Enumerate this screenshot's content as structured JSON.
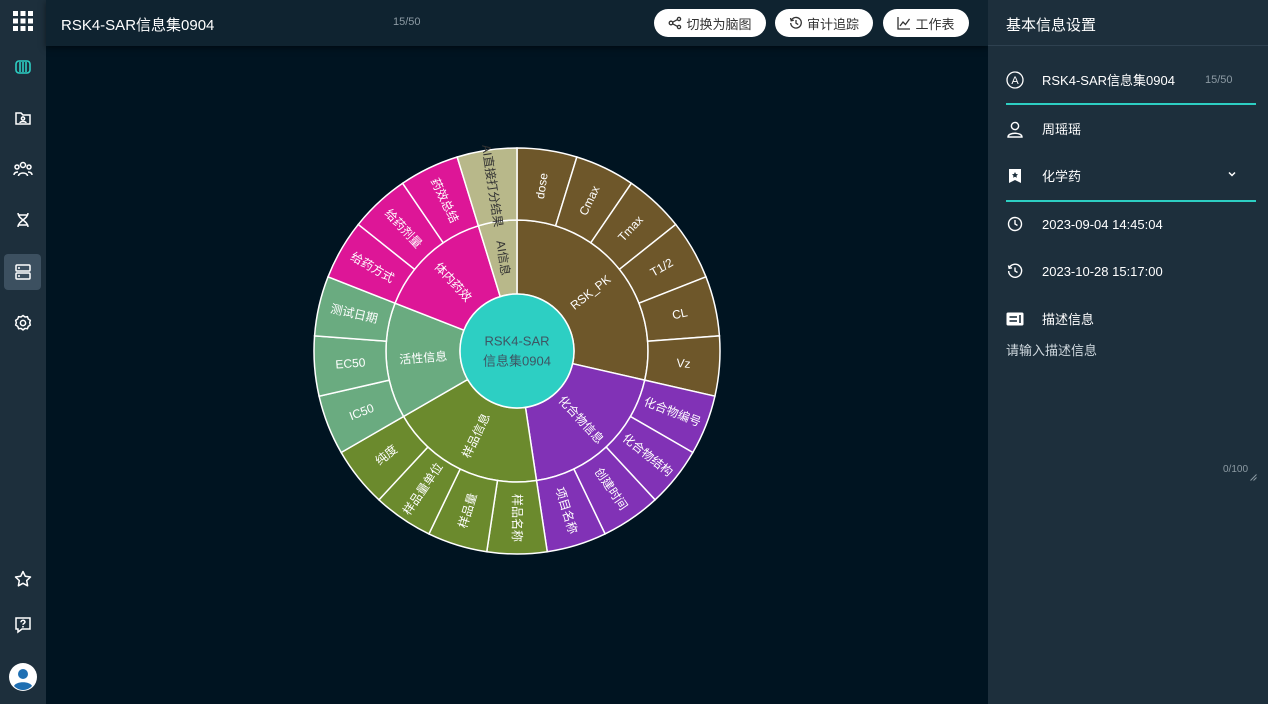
{
  "rail": {
    "icons": [
      "apps-grid-icon",
      "structure-icon",
      "folder-user-icon",
      "team-icon",
      "dna-icon",
      "database-icon",
      "settings-icon",
      "star-icon",
      "help-icon",
      "avatar"
    ]
  },
  "header": {
    "title": "RSK4-SAR信息集0904",
    "count": "15/50",
    "buttons": {
      "mindmap": "切换为脑图",
      "audit": "审计追踪",
      "worksheet": "工作表"
    }
  },
  "chart_data": {
    "type": "sunburst",
    "center": {
      "label_line1": "RSK4-SAR",
      "label_line2": "信息集0904",
      "color": "#2dcfc3"
    },
    "groups": [
      {
        "name": "RSK_PK",
        "color": "#6e572a",
        "children": [
          "dose",
          "Cmax",
          "Tmax",
          "T1/2",
          "CL",
          "Vz"
        ]
      },
      {
        "name": "化合物信息",
        "color": "#8132b6",
        "children": [
          "化合物编号",
          "化合物结构",
          "创建时间",
          "项目名称"
        ]
      },
      {
        "name": "样品信息",
        "color": "#6b8a2d",
        "children": [
          "样品名称",
          "样品量",
          "样品量单位",
          "纯度"
        ]
      },
      {
        "name": "活性信息",
        "color": "#6aab80",
        "children": [
          "IC50",
          "EC50",
          "测试日期"
        ]
      },
      {
        "name": "体内药效",
        "color": "#dd1697",
        "children": [
          "给药方式",
          "给药剂量",
          "药效总结"
        ]
      },
      {
        "name": "AI信息",
        "color": "#b8b88a",
        "children": [
          "AI直接打分结果"
        ]
      }
    ]
  },
  "panel": {
    "title": "基本信息设置",
    "name_value": "RSK4-SAR信息集0904",
    "name_count": "15/50",
    "owner": "周瑶瑶",
    "category": "化学药",
    "created": "2023-09-04 14:45:04",
    "updated": "2023-10-28 15:17:00",
    "desc_label": "描述信息",
    "desc_placeholder": "请输入描述信息",
    "desc_count": "0/100"
  },
  "colors": {
    "accent": "#2dcfc3",
    "rail_bg": "#1d2f3c",
    "canvas_bg": "#001421"
  }
}
